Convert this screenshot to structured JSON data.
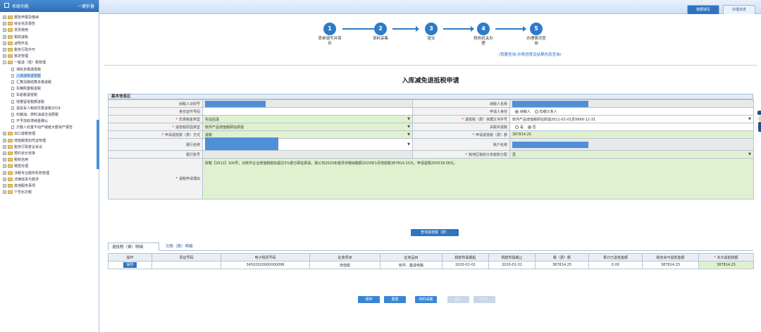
{
  "sidebar": {
    "title": "系统功能",
    "collapse_label": "一键折叠",
    "items": [
      {
        "label": "报告申报及缴纳",
        "kind": "folder"
      },
      {
        "label": "综合信息报告",
        "kind": "folder"
      },
      {
        "label": "发票使用",
        "kind": "folder"
      },
      {
        "label": "税收减免",
        "kind": "folder"
      },
      {
        "label": "证明开具",
        "kind": "folder"
      },
      {
        "label": "税务行政许可",
        "kind": "folder"
      },
      {
        "label": "核定管理",
        "kind": "folder"
      },
      {
        "label": "一般退（抵）税管理",
        "kind": "folder-open"
      },
      {
        "label": "误收多缴退抵税",
        "kind": "doc"
      },
      {
        "label": "入库减免退抵税",
        "kind": "doc",
        "selected": true
      },
      {
        "label": "汇算清缴结算多缴退税",
        "kind": "doc"
      },
      {
        "label": "车辆购置税退税",
        "kind": "doc"
      },
      {
        "label": "车船税退抵税",
        "kind": "doc"
      },
      {
        "label": "增量留抵税额退税",
        "kind": "doc"
      },
      {
        "label": "退役军人税收优惠退税2019",
        "kind": "doc"
      },
      {
        "label": "石脑油、燃料油退还消费税",
        "kind": "doc"
      },
      {
        "label": "不予加收滞纳金确认",
        "kind": "doc"
      },
      {
        "label": "欠税人处置不动产或者大额资产报告",
        "kind": "doc"
      },
      {
        "label": "出口退税管理",
        "kind": "folder"
      },
      {
        "label": "增值税抵扣凭证管理",
        "kind": "folder"
      },
      {
        "label": "税务行政复议诉讼",
        "kind": "folder"
      },
      {
        "label": "预约定价安排",
        "kind": "folder"
      },
      {
        "label": "税收信用",
        "kind": "folder"
      },
      {
        "label": "稽查处理",
        "kind": "folder"
      },
      {
        "label": "涉税专业服务机构管理",
        "kind": "folder"
      },
      {
        "label": "法律追责与救济",
        "kind": "folder"
      },
      {
        "label": "其他服务事项",
        "kind": "folder"
      },
      {
        "label": "个性化办税",
        "kind": "folder"
      }
    ]
  },
  "topbar": {
    "tab_active": "我要填写",
    "tab_other": "办理状态"
  },
  "steps": [
    {
      "num": "1",
      "label": "表单填写并保存"
    },
    {
      "num": "2",
      "label": "资料采集"
    },
    {
      "num": "3",
      "label": "提交"
    },
    {
      "num": "4",
      "label": "税务机关办理"
    },
    {
      "num": "5",
      "label": "办理情况查询"
    }
  ],
  "step_link": "(我要查询-办税进度及结果信息查询)",
  "page_title": "入库减免退抵税申请",
  "section_title": "基本信息区",
  "form": {
    "taxpayer_id_label": "纳税人识别号",
    "taxpayer_name_label": "纳税人名称",
    "id_doc_label": "身份证件号码",
    "applicant_id_label": "申请人身份",
    "applicant_opt1": "纳税人",
    "applicant_opt2": "扣缴义务人",
    "reduction_type_label": "优惠税金类型",
    "reduction_type_value": "先征后退",
    "doc_no_label": "退抵税（费）依据文书字号",
    "doc_no_value": "软件产品增值税即征即退2011-01-01至9999-12-31",
    "reason_type_label": "退抵税原因类型",
    "reason_type_value": "软件产品增值税即征即退",
    "joint_refund_label": "关联并退税",
    "joint_yes": "是",
    "joint_no": "否",
    "method_label": "申请退抵税（费）方式",
    "method_value": "退税",
    "amount_label": "申请退抵税（费）额",
    "amount_value": "387814.25",
    "bank_name_label": "银行名称",
    "account_name_label": "账户名称",
    "bank_account_label": "银行账号",
    "cross_region_label": "跨地区税收分享税款分配",
    "cross_region_value": "否",
    "reason_label": "退税申请理由",
    "reason_value": "财税【2011】100号，对软件企业增值税税负超过3%部分即征即退。我公司2020年度月份缴纳税额2020年1月增值税387814.25元，申请退税293318.08元。"
  },
  "query_button": "查询退抵税（费）",
  "detail_tabs": {
    "tab1": "退抵税（费）明细",
    "tab2": "欠税（费）明细"
  },
  "detail": {
    "headers": [
      "操作",
      "票证号码",
      "电子税票号码",
      "征收项目",
      "征收品目",
      "税款所属期起",
      "税款所属期止",
      "税（费）额",
      "累计已退抵金额",
      "税务余可退抵金额",
      "本次退抵税额"
    ],
    "rows": [
      {
        "op": "操作",
        "ticket": "",
        "eticket": "34502020000000096",
        "item": "增值税",
        "subitem": "软件、集成电路",
        "start": "2020-01-01",
        "end": "2020-01-31",
        "tax": "387814.25",
        "refunded": "0.00",
        "remaining": "387814.25",
        "current": "387814.25"
      }
    ]
  },
  "buttons": {
    "save": "保存",
    "reset": "重置",
    "collect": "资料采集",
    "submit": "提交",
    "print": "打印"
  },
  "colors": {
    "accent": "#2f74c0",
    "green_field": "#dff1cf",
    "required": "#dd0000"
  }
}
